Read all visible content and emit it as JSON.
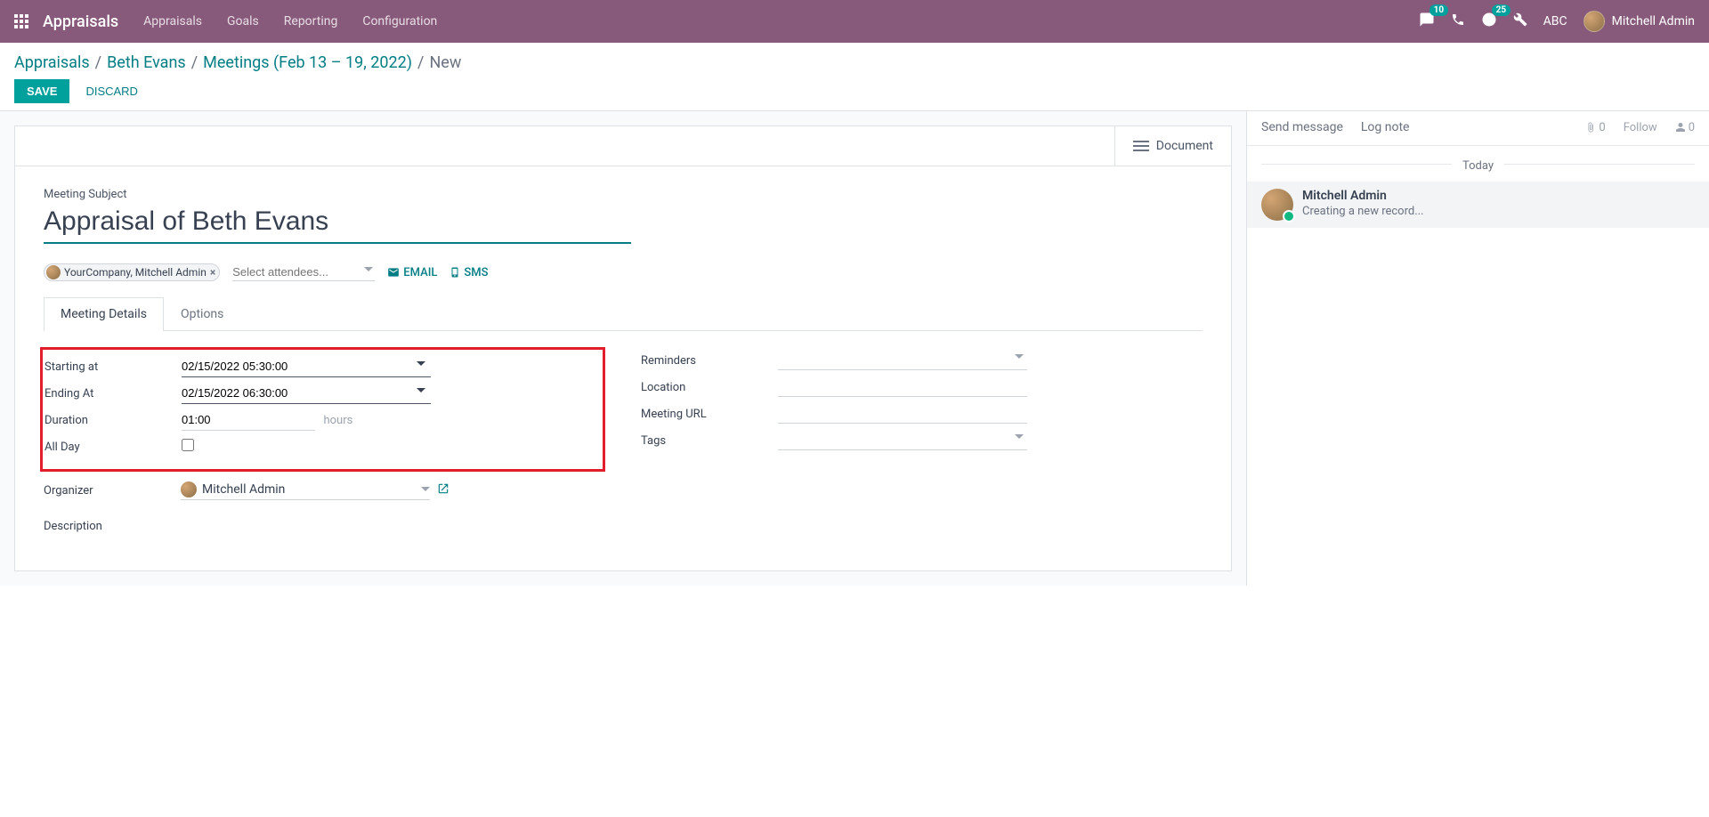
{
  "nav": {
    "brand": "Appraisals",
    "menu": [
      "Appraisals",
      "Goals",
      "Reporting",
      "Configuration"
    ],
    "chat_badge": "10",
    "clock_badge": "25",
    "company": "ABC",
    "user": "Mitchell Admin"
  },
  "breadcrumb": {
    "items": [
      "Appraisals",
      "Beth Evans",
      "Meetings (Feb 13 – 19, 2022)"
    ],
    "current": "New"
  },
  "actions": {
    "save": "SAVE",
    "discard": "DISCARD"
  },
  "buttonbox": {
    "document": "Document"
  },
  "form": {
    "subject_label": "Meeting Subject",
    "subject_value": "Appraisal of Beth Evans",
    "attendee_tag": "YourCompany, Mitchell Admin",
    "attendee_placeholder": "Select attendees...",
    "email": "EMAIL",
    "sms": "SMS"
  },
  "tabs": {
    "meeting_details": "Meeting Details",
    "options": "Options"
  },
  "fields": {
    "starting_label": "Starting at",
    "starting_value": "02/15/2022 05:30:00",
    "ending_label": "Ending At",
    "ending_value": "02/15/2022 06:30:00",
    "duration_label": "Duration",
    "duration_value": "01:00",
    "duration_suffix": "hours",
    "allday_label": "All Day",
    "organizer_label": "Organizer",
    "organizer_value": "Mitchell Admin",
    "reminders_label": "Reminders",
    "location_label": "Location",
    "meetingurl_label": "Meeting URL",
    "tags_label": "Tags",
    "description_label": "Description"
  },
  "chatter": {
    "send_message": "Send message",
    "log_note": "Log note",
    "attach_count": "0",
    "follow": "Follow",
    "follower_count": "0",
    "today": "Today",
    "msg_author": "Mitchell Admin",
    "msg_text": "Creating a new record..."
  }
}
